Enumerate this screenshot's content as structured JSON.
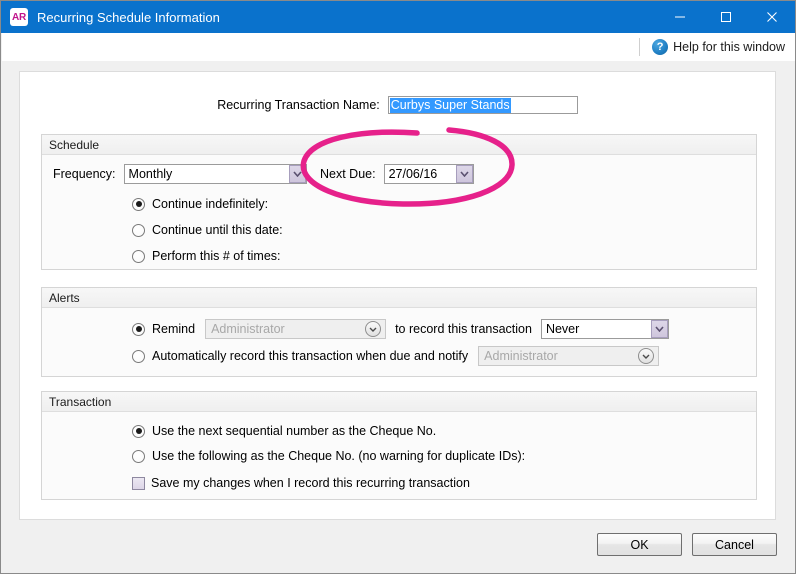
{
  "window": {
    "title": "Recurring Schedule Information",
    "app_icon_text": "AR",
    "controls": {
      "minimize": "minimize-icon",
      "maximize": "maximize-icon",
      "close": "close-icon"
    }
  },
  "help": {
    "icon": "question-mark-icon",
    "label": "Help for this window"
  },
  "form": {
    "name_label": "Recurring Transaction Name:",
    "name_value": "Curbys Super Stands"
  },
  "schedule": {
    "title": "Schedule",
    "frequency_label": "Frequency:",
    "frequency_value": "Monthly",
    "next_due_label": "Next Due:",
    "next_due_value": "27/06/16",
    "options": [
      {
        "label": "Continue indefinitely:",
        "checked": true
      },
      {
        "label": "Continue until this date:",
        "checked": false
      },
      {
        "label": "Perform this # of times:",
        "checked": false
      }
    ]
  },
  "alerts": {
    "title": "Alerts",
    "remind_label": "Remind",
    "remind_user": "Administrator",
    "remind_mid_label": "to record this transaction",
    "remind_frequency": "Never",
    "remind_checked": true,
    "auto_label": "Automatically record this transaction when due and notify",
    "auto_user": "Administrator",
    "auto_checked": false
  },
  "transaction": {
    "title": "Transaction",
    "options": [
      {
        "label": "Use the next sequential number as the Cheque No.",
        "checked": true
      },
      {
        "label": "Use the following as the Cheque No. (no warning for duplicate IDs):",
        "checked": false
      }
    ],
    "save_changes_label": "Save my changes when I record this recurring transaction",
    "save_changes_checked": false
  },
  "buttons": {
    "ok": "OK",
    "cancel": "Cancel"
  },
  "annotation": {
    "shape": "hand-drawn-ellipse",
    "color": "#E6218B",
    "target": "Next Due date field"
  },
  "colors": {
    "titlebar": "#0a72cc",
    "selection": "#3399ff",
    "annotation": "#E6218B",
    "combo_arrow": "#cfc6dd"
  }
}
